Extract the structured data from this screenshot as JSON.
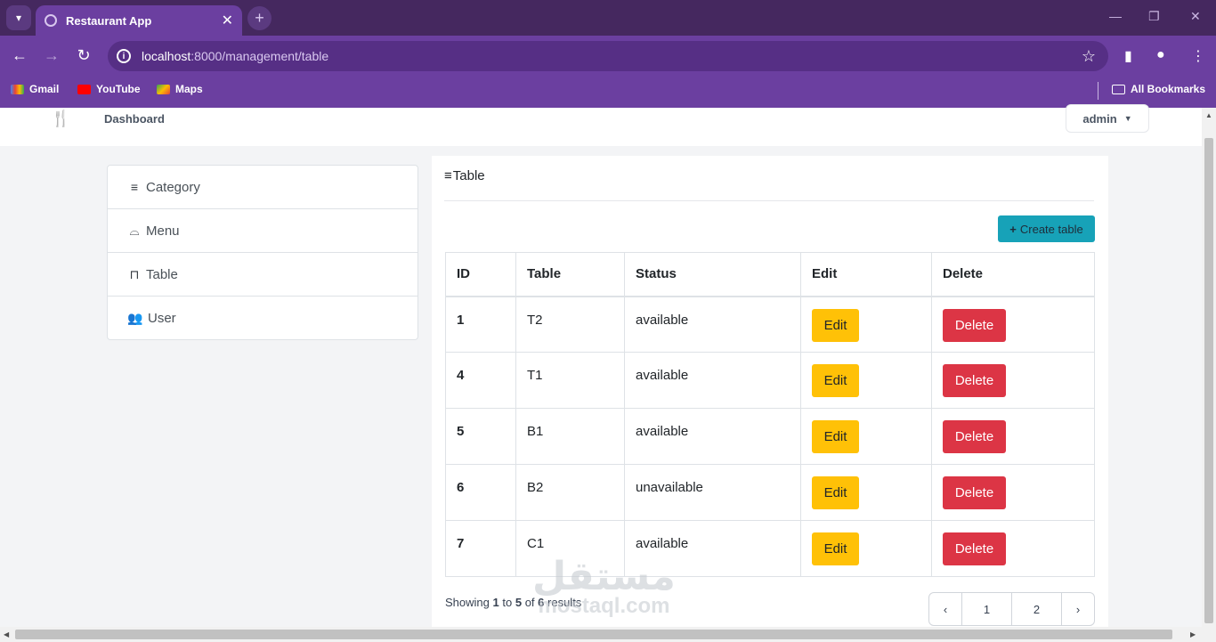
{
  "browser": {
    "tab_title": "Restaurant App",
    "url_host": "localhost",
    "url_path": ":8000/management/table",
    "bookmarks": [
      "Gmail",
      "YouTube",
      "Maps"
    ],
    "all_bookmarks": "All Bookmarks"
  },
  "nav": {
    "dashboard": "Dashboard",
    "user_menu": "admin"
  },
  "sidebar": {
    "items": [
      {
        "label": "Category",
        "icon": "list-icon"
      },
      {
        "label": "Menu",
        "icon": "burger-icon"
      },
      {
        "label": "Table",
        "icon": "chair-icon"
      },
      {
        "label": "User",
        "icon": "users-icon"
      }
    ]
  },
  "panel": {
    "title": "Table",
    "create_label": "Create table"
  },
  "table": {
    "headers": [
      "ID",
      "Table",
      "Status",
      "Edit",
      "Delete"
    ],
    "rows": [
      {
        "id": "1",
        "name": "T2",
        "status": "available"
      },
      {
        "id": "4",
        "name": "T1",
        "status": "available"
      },
      {
        "id": "5",
        "name": "B1",
        "status": "available"
      },
      {
        "id": "6",
        "name": "B2",
        "status": "unavailable"
      },
      {
        "id": "7",
        "name": "C1",
        "status": "available"
      }
    ],
    "edit_label": "Edit",
    "delete_label": "Delete"
  },
  "pagination": {
    "showing_prefix": "Showing",
    "from": "1",
    "to_word": "to",
    "to": "5",
    "of_word": "of",
    "total": "6",
    "results_word": "results",
    "pages": [
      "1",
      "2"
    ]
  },
  "watermark": {
    "arabic": "مستقل",
    "latin": "mostaql.com"
  },
  "colors": {
    "brand_purple": "#6b3fa0",
    "accent_teal": "#17a2b8",
    "edit_yellow": "#ffc107",
    "delete_red": "#dc3545"
  }
}
